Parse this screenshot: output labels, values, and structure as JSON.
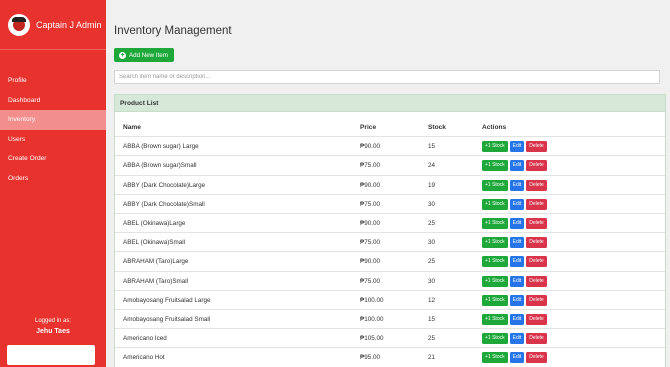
{
  "sidebar": {
    "brand": "Captain J Admin",
    "items": [
      {
        "label": "Profile",
        "name": "sidebar-item-profile",
        "active": false
      },
      {
        "label": "Dashboard",
        "name": "sidebar-item-dashboard",
        "active": false
      },
      {
        "label": "Inventory",
        "name": "sidebar-item-inventory",
        "active": true
      },
      {
        "label": "Users",
        "name": "sidebar-item-users",
        "active": false
      },
      {
        "label": "Create Order",
        "name": "sidebar-item-create-order",
        "active": false
      },
      {
        "label": "Orders",
        "name": "sidebar-item-orders",
        "active": false
      }
    ],
    "logged_in_label": "Logged in as:",
    "logged_in_user": "Jehu Taes"
  },
  "main": {
    "title": "Inventory Management",
    "add_button": "Add New Item",
    "search_placeholder": "Search item name or description...",
    "panel_title": "Product List",
    "columns": [
      "Name",
      "Price",
      "Stock",
      "Actions"
    ],
    "action_labels": {
      "stock": "+1 Stock",
      "edit": "Edit",
      "delete": "Delete"
    },
    "rows": [
      {
        "name": "ABBA (Brown sugar) Large",
        "price": "₱90.00",
        "stock": "15"
      },
      {
        "name": "ABBA (Brown sugar)Small",
        "price": "₱75.00",
        "stock": "24"
      },
      {
        "name": "ABBY (Dark Chocolate)Large",
        "price": "₱90.00",
        "stock": "19"
      },
      {
        "name": "ABBY (Dark Chocolate)Small",
        "price": "₱75.00",
        "stock": "30"
      },
      {
        "name": "ABEL (Okinawa)Large",
        "price": "₱90.00",
        "stock": "25"
      },
      {
        "name": "ABEL (Okinawa)Small",
        "price": "₱75.00",
        "stock": "30"
      },
      {
        "name": "ABRAHAM (Taro)Large",
        "price": "₱90.00",
        "stock": "25"
      },
      {
        "name": "ABRAHAM (Taro)Small",
        "price": "₱75.00",
        "stock": "30"
      },
      {
        "name": "Amobayosang Fruitsalad Large",
        "price": "₱100.00",
        "stock": "12"
      },
      {
        "name": "Amobayosang Fruitsalad Small",
        "price": "₱100.00",
        "stock": "15"
      },
      {
        "name": "Americano Iced",
        "price": "₱105.00",
        "stock": "25"
      },
      {
        "name": "Americano Hot",
        "price": "₱95.00",
        "stock": "21"
      }
    ]
  },
  "colors": {
    "sidebar": "#e8322e",
    "success": "#1fa83a",
    "primary": "#2575e8",
    "danger": "#d9344a",
    "panel_header": "#d6e8d7"
  }
}
